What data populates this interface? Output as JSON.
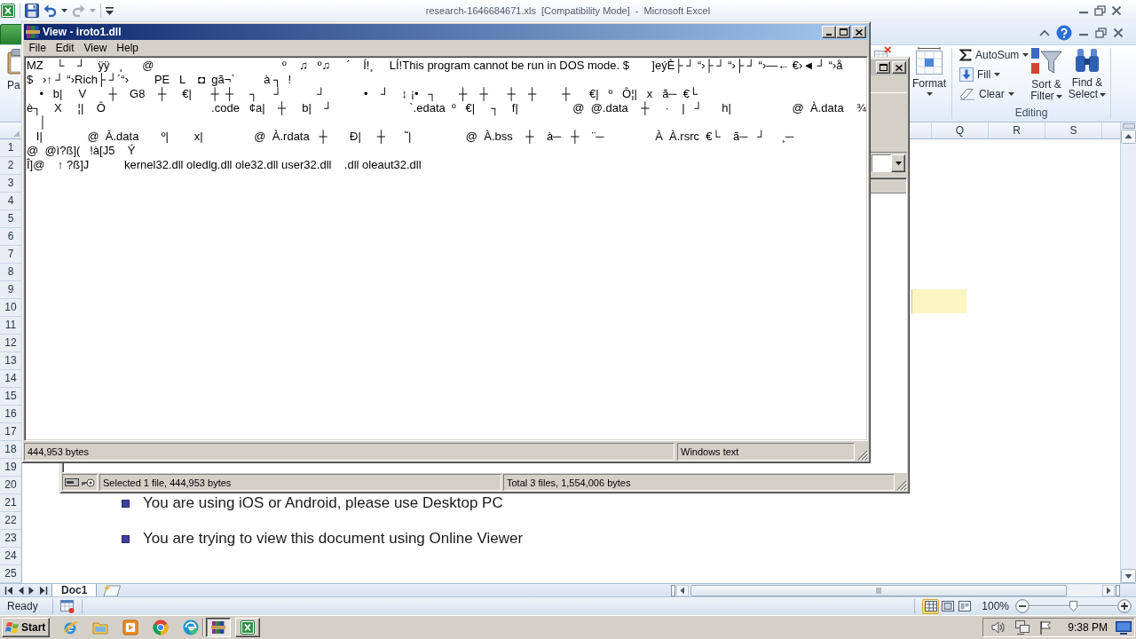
{
  "excel": {
    "title": "research-1646684671.xls  [Compatibility Mode]  -  Microsoft Excel",
    "ribbon": {
      "paste_label": "Pa",
      "format_label": "Format",
      "editing": {
        "label": "Editing",
        "buttons": [
          {
            "kind": "small",
            "label": "AutoSum"
          },
          {
            "kind": "small",
            "label": "Fill"
          },
          {
            "kind": "small",
            "label": "Clear"
          },
          {
            "kind": "large",
            "label": "Sort & Filter"
          },
          {
            "kind": "large",
            "label": "Find & Select"
          }
        ]
      }
    },
    "columns": [
      "Q",
      "R",
      "S"
    ],
    "rows": [
      {
        "number": "1"
      },
      {
        "number": "2"
      },
      {
        "number": "3"
      },
      {
        "number": "4"
      },
      {
        "number": "5"
      },
      {
        "number": "6"
      },
      {
        "number": "7"
      },
      {
        "number": "8"
      },
      {
        "number": "9"
      },
      {
        "number": "10"
      },
      {
        "number": "11"
      },
      {
        "number": "12"
      },
      {
        "number": "13"
      },
      {
        "number": "14"
      },
      {
        "number": "15"
      },
      {
        "number": "16"
      },
      {
        "number": "17"
      },
      {
        "number": "18"
      },
      {
        "number": "19"
      },
      {
        "number": "20"
      },
      {
        "number": "21",
        "bullet": "You are using iOS or Android, please use Desktop PC"
      },
      {
        "number": "22"
      },
      {
        "number": "23",
        "bullet": "You are trying to view this document using Online Viewer"
      },
      {
        "number": "24"
      },
      {
        "number": "25"
      }
    ],
    "sheet_tabs": [
      {
        "label": "Doc1",
        "selected": true
      }
    ],
    "status": "Ready",
    "view_buttons": [
      {
        "selected": true
      },
      {
        "selected": false
      },
      {
        "selected": false
      }
    ],
    "zoom": {
      "reading": "100%",
      "level": 0.5
    }
  },
  "archiver": {
    "status": [
      "Selected 1 file, 444,953 bytes",
      "Total 3 files, 1,554,006 bytes"
    ]
  },
  "viewer": {
    "title": "View - iroto1.dll",
    "menu": [
      "File",
      "Edit",
      "View",
      "Help"
    ],
    "lines": [
      "MZ    └    ┘    ÿÿ   ¸      @                                        º    ♫   º♫     ´    Í!¸     LÍ!This program cannot be run in DOS mode. $       ]eýÈ├ ┘ “›├ ┘ “›├ ┘ “›—← €›◄ ┘ “›å",
      "$   ›↑ ┘ “›Rich├ ┘´“›        PE   L    ◘  gã¬`         à ┐  !",
      "    •   b|     V       ┼    G8    ┼     €|      ┼  ┼     ┐     ┘           ┘            •    ┘    ↕ ¡•   ┐       ┼    ┼      ┼    ┼        ┼      €|   º   Ô¦|   x   ã─  €└",
      "è┐    X     ¦|    Ô                                 .code   ¢a|    ┼     b|    ┘                        `.edata  º   €|     ┐    f|                 @  @.data    ┼     ·    |   ┘      h|                   @  À.data    ¾",
      "    │",
      "   I|              @  À.data       º|        x|                @  À.rdata   ┼       Ð|     ┼      ˜|                 @  À.bss    ┼    à─   ┼    ¨─                À  À.rsrc  €└    ã─   ┘     ¸─",
      "@  @ì?ß](   !à[J5    Ý",
      "Î]@    ↑ ?ß]J           kernel32.dll oledlg.dll ole32.dll user32.dll    .dll oleaut32.dll"
    ],
    "status": [
      "444,953 bytes",
      "Windows text"
    ]
  },
  "taskbar": {
    "start": "Start",
    "tasks": [
      {
        "active": true
      },
      {
        "active": false
      }
    ],
    "clock": "9:38 PM"
  }
}
